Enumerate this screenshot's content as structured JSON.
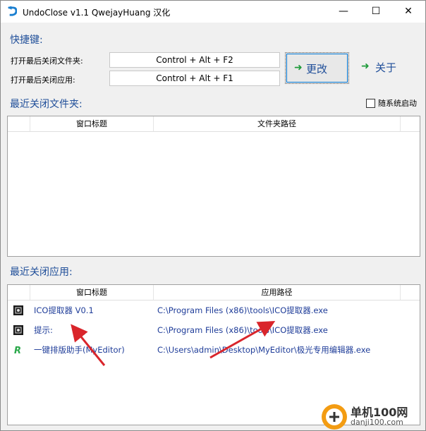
{
  "window": {
    "title": "UndoClose v1.1  QwejayHuang 汉化",
    "minimize": "—",
    "maximize": "☐",
    "close": "✕"
  },
  "hotkeys": {
    "section_title": "快捷键:",
    "folder_label": "打开最后关闭文件夹:",
    "folder_value": "Control + Alt + F2",
    "app_label": "打开最后关闭应用:",
    "app_value": "Control + Alt + F1",
    "change_label": "更改",
    "about_label": "关于"
  },
  "folders": {
    "section_title": "最近关闭文件夹:",
    "autostart_label": "随系统启动",
    "autostart_checked": false,
    "columns": [
      "窗口标题",
      "文件夹路径"
    ],
    "rows": []
  },
  "apps": {
    "section_title": "最近关闭应用:",
    "columns": [
      "窗口标题",
      "应用路径"
    ],
    "rows": [
      {
        "icon": "ico-extractor-icon",
        "title": "ICO提取器 V0.1",
        "path": "C:\\Program Files (x86)\\tools\\ICO提取器.exe"
      },
      {
        "icon": "ico-extractor-icon",
        "title": "提示:",
        "path": "C:\\Program Files (x86)\\tools\\ICO提取器.exe"
      },
      {
        "icon": "myeditor-icon",
        "title": "一键排版助手(MyEditor)",
        "path": "C:\\Users\\admin\\Desktop\\MyEditor\\极光专用编辑器.exe"
      }
    ]
  },
  "watermark": {
    "brand": "单机100网",
    "url": "danji100.com"
  },
  "colors": {
    "section_title": "#1f4e99",
    "list_text": "#1f3d99",
    "arrow_green": "#1e9a3a",
    "annotation_red": "#d9252b",
    "watermark_orange": "#f39c12"
  }
}
